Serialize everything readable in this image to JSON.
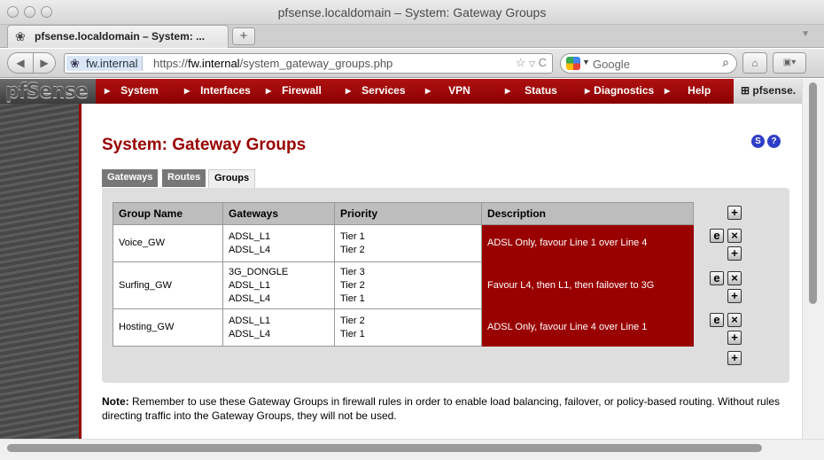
{
  "window": {
    "title": "pfsense.localdomain – System: Gateway Groups"
  },
  "browser": {
    "tab_title": "pfsense.localdomain – System: ...",
    "new_tab_label": "+",
    "site_identity": "fw.internal",
    "url_prefix": "https://",
    "url_host": "fw.internal",
    "url_path": "/system_gateway_groups.php",
    "search_placeholder": "Google"
  },
  "app": {
    "logo": "Sense",
    "logo_prefix": "pf",
    "menu": [
      "System",
      "Interfaces",
      "Firewall",
      "Services",
      "VPN",
      "Status",
      "Diagnostics",
      "Help"
    ],
    "hostname": "pfsense."
  },
  "page": {
    "title": "System: Gateway Groups",
    "help_s": "S",
    "help_q": "?",
    "tabs": [
      "Gateways",
      "Routes",
      "Groups"
    ],
    "active_tab": "Groups"
  },
  "table": {
    "headers": [
      "Group Name",
      "Gateways",
      "Priority",
      "Description"
    ],
    "rows": [
      {
        "name": "Voice_GW",
        "gateways": [
          "ADSL_L1",
          "ADSL_L4"
        ],
        "priority": [
          "Tier 1",
          "Tier 2"
        ],
        "description": "ADSL Only, favour Line 1 over Line 4"
      },
      {
        "name": "Surfing_GW",
        "gateways": [
          "3G_DONGLE",
          "ADSL_L1",
          "ADSL_L4"
        ],
        "priority": [
          "Tier 3",
          "Tier 2",
          "Tier 1"
        ],
        "description": "Favour L4, then L1, then failover to 3G"
      },
      {
        "name": "Hosting_GW",
        "gateways": [
          "ADSL_L1",
          "ADSL_L4"
        ],
        "priority": [
          "Tier 2",
          "Tier 1"
        ],
        "description": "ADSL Only, favour Line 4 over Line 1"
      }
    ]
  },
  "note": {
    "label": "Note:",
    "text": "Remember to use these Gateway Groups in firewall rules in order to enable load balancing, failover, or policy-based routing. Without rules directing traffic into the Gateway Groups, they will not be used."
  },
  "colors": {
    "brand_red": "#990000",
    "link_blue": "#2f3ec8"
  }
}
